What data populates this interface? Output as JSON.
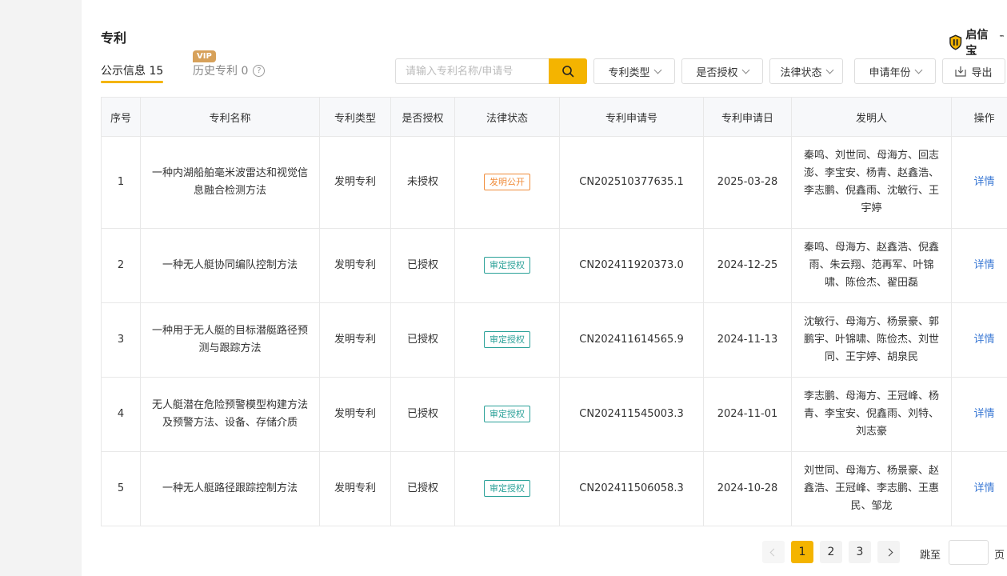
{
  "section_title": "专利",
  "brand": {
    "name": "启信宝",
    "tm": "™"
  },
  "tabs": {
    "public": "公示信息 15",
    "history": "历史专利 0",
    "vip_badge": "VIP",
    "help_glyph": "?"
  },
  "search": {
    "placeholder": "请输入专利名称/申请号"
  },
  "filters": [
    "专利类型",
    "是否授权",
    "法律状态",
    "申请年份"
  ],
  "export_label": "导出",
  "table": {
    "headers": [
      "序号",
      "专利名称",
      "专利类型",
      "是否授权",
      "法律状态",
      "专利申请号",
      "专利申请日",
      "发明人",
      "操作"
    ],
    "rows": [
      {
        "index": "1",
        "name": "一种内湖船舶毫米波雷达和视觉信息融合检测方法",
        "type": "发明专利",
        "granted": "未授权",
        "status": "发明公开",
        "status_kind": "orange",
        "app_no": "CN202510377635.1",
        "app_date": "2025-03-28",
        "inventors": "秦鸣、刘世同、母海方、回志澎、李宝安、杨青、赵鑫浩、李志鹏、倪鑫雨、沈敏行、王宇婷",
        "action": "详情"
      },
      {
        "index": "2",
        "name": "一种无人艇协同编队控制方法",
        "type": "发明专利",
        "granted": "已授权",
        "status": "审定授权",
        "status_kind": "teal",
        "app_no": "CN202411920373.0",
        "app_date": "2024-12-25",
        "inventors": "秦鸣、母海方、赵鑫浩、倪鑫雨、朱云翔、范再军、叶锦啸、陈俭杰、翟田磊",
        "action": "详情"
      },
      {
        "index": "3",
        "name": "一种用于无人艇的目标潜艇路径预测与跟踪方法",
        "type": "发明专利",
        "granted": "已授权",
        "status": "审定授权",
        "status_kind": "teal",
        "app_no": "CN202411614565.9",
        "app_date": "2024-11-13",
        "inventors": "沈敏行、母海方、杨景豪、郭鹏宇、叶锦啸、陈俭杰、刘世同、王宇婷、胡泉民",
        "action": "详情"
      },
      {
        "index": "4",
        "name": "无人艇潜在危险预警模型构建方法及预警方法、设备、存储介质",
        "type": "发明专利",
        "granted": "已授权",
        "status": "审定授权",
        "status_kind": "teal",
        "app_no": "CN202411545003.3",
        "app_date": "2024-11-01",
        "inventors": "李志鹏、母海方、王冠峰、杨青、李宝安、倪鑫雨、刘特、刘志豪",
        "action": "详情"
      },
      {
        "index": "5",
        "name": "一种无人艇路径跟踪控制方法",
        "type": "发明专利",
        "granted": "已授权",
        "status": "审定授权",
        "status_kind": "teal",
        "app_no": "CN202411506058.3",
        "app_date": "2024-10-28",
        "inventors": "刘世同、母海方、杨景豪、赵鑫浩、王冠峰、李志鹏、王惠民、邹龙",
        "action": "详情"
      }
    ]
  },
  "pagination": {
    "pages": [
      "1",
      "2",
      "3"
    ],
    "active": "1",
    "jump_label": "跳至",
    "page_suffix": "页"
  },
  "colors": {
    "accent": "#f4b400",
    "link": "#3a78d4",
    "orange_tag": "#f08c3a",
    "teal_tag": "#2aa198"
  }
}
